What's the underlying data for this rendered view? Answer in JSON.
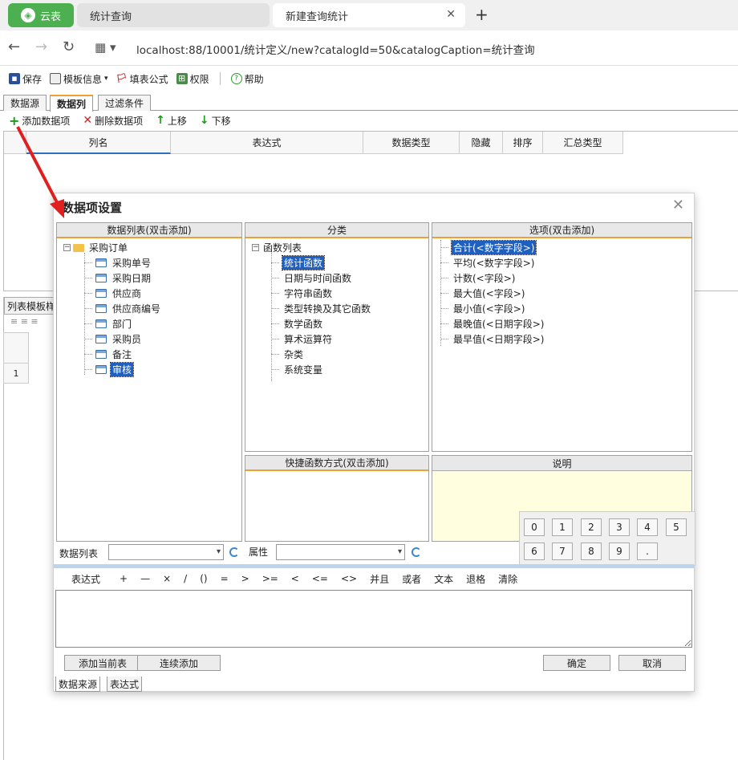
{
  "browser": {
    "app_tab": "云表",
    "tabs": [
      "统计查询",
      "新建查询统计"
    ],
    "url": "localhost:88/10001/统计定义/new?catalogId=50&catalogCaption=统计查询"
  },
  "toolbar": {
    "save": "保存",
    "template_info": "模板信息",
    "formula": "填表公式",
    "permission": "权限",
    "help": "帮助"
  },
  "main_tabs": [
    "数据源",
    "数据列",
    "过滤条件"
  ],
  "datacol_toolbar": {
    "add": "添加数据项",
    "delete": "删除数据项",
    "up": "上移",
    "down": "下移"
  },
  "grid_headers": [
    "列名",
    "表达式",
    "数据类型",
    "隐藏",
    "排序",
    "汇总类型"
  ],
  "template_tab": "列表模板样",
  "template_row": "1",
  "dialog": {
    "title": "数据项设置",
    "data_panel": {
      "header": "数据列表(双击添加)",
      "root": "采购订单",
      "items": [
        "采购单号",
        "采购日期",
        "供应商",
        "供应商编号",
        "部门",
        "采购员",
        "备注",
        "审核"
      ]
    },
    "category_panel": {
      "header": "分类",
      "root": "函数列表",
      "items": [
        "统计函数",
        "日期与时间函数",
        "字符串函数",
        "类型转换及其它函数",
        "数学函数",
        "算术运算符",
        "杂类",
        "系统变量"
      ]
    },
    "options_panel": {
      "header": "选项(双击添加)",
      "items": [
        "合计(<数字字段>)",
        "平均(<数字字段>)",
        "计数(<字段>)",
        "最大值(<字段>)",
        "最小值(<字段>)",
        "最晚值(<日期字段>)",
        "最早值(<日期字段>)"
      ]
    },
    "shortcut_panel": {
      "header": "快捷函数方式(双击添加)"
    },
    "desc_panel": {
      "header": "说明"
    },
    "numpad": [
      "0",
      "1",
      "2",
      "3",
      "4",
      "5",
      "6",
      "7",
      "8",
      "9",
      "."
    ],
    "data_list_label": "数据列表",
    "attr_label": "属性",
    "expr_toolbar": [
      "表达式",
      "+",
      "—",
      "×",
      "/",
      "()",
      "=",
      ">",
      ">=",
      "<",
      "<=",
      "<>",
      "并且",
      "或者",
      "文本",
      "退格",
      "清除"
    ],
    "btn_add_current": "添加当前表",
    "btn_continuous_add": "连续添加",
    "btn_ok": "确定",
    "btn_cancel": "取消",
    "bottom_tabs": [
      "数据来源",
      "表达式"
    ]
  },
  "colors": {
    "app_green": "#4caf50",
    "accent_orange": "#f0a030",
    "selection_blue": "#1e5fbf",
    "desc_bg": "#ffffe0",
    "arrow_red": "#e02020"
  }
}
